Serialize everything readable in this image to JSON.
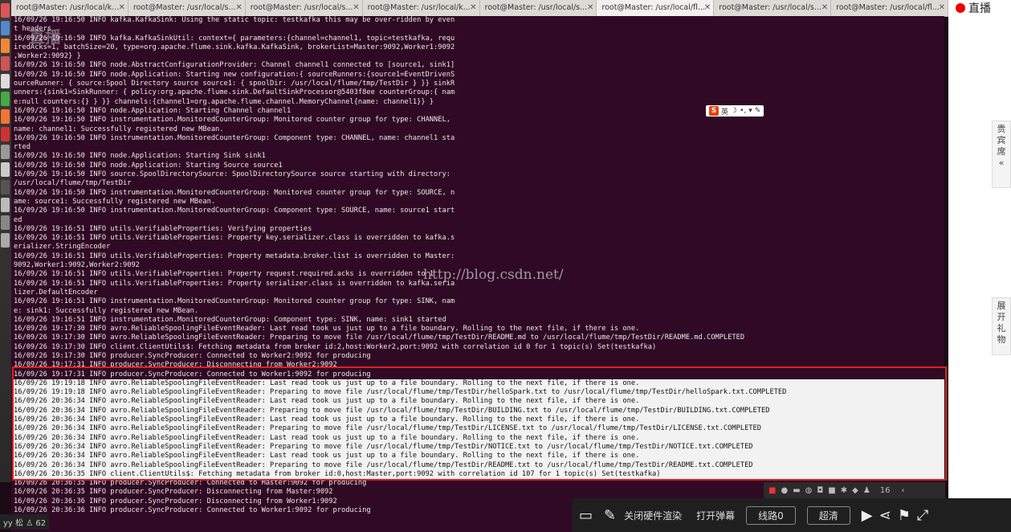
{
  "tabs": [
    {
      "label": "root@Master: /usr/local/k..."
    },
    {
      "label": "root@Master: /usr/local/s..."
    },
    {
      "label": "root@Master: /usr/local/s..."
    },
    {
      "label": "root@Master: /usr/local/k..."
    },
    {
      "label": "root@Master: /usr/local/s..."
    },
    {
      "label": "root@Master: /usr/local/fl..."
    },
    {
      "label": "root@Master: /usr/local/s..."
    },
    {
      "label": "root@Master: /usr/local/fl..."
    }
  ],
  "terminal": {
    "lines": [
      "16/09/26 19:16:50 INFO kafka.KafkaSink: Using the static topic: testkafka this may be over-ridden by even",
      "t headers",
      "16/09/26 19:16:50 INFO kafka.KafkaSinkUtil: context={ parameters:{channel=channel1, topic=testkafka, requ",
      "iredAcks=1, batchSize=20, type=org.apache.flume.sink.kafka.KafkaSink, brokerList=Master:9092,Worker1:9092",
      ",Worker2:9092} }",
      "16/09/26 19:16:50 INFO node.AbstractConfigurationProvider: Channel channel1 connected to [source1, sink1]",
      "16/09/26 19:16:50 INFO node.Application: Starting new configuration:{ sourceRunners:{source1=EventDrivenS",
      "ourceRunner: { source:Spool Directory source source1: { spoolDir: /usr/local/flume/tmp/TestDir } }} sinkR",
      "unners:{sink1=SinkRunner: { policy:org.apache.flume.sink.DefaultSinkProcessor@5403f8ee counterGroup:{ nam",
      "e:null counters:{} } }} channels:{channel1=org.apache.flume.channel.MemoryChannel{name: channel1}} }",
      "16/09/26 19:16:50 INFO node.Application: Starting Channel channel1",
      "16/09/26 19:16:50 INFO instrumentation.MonitoredCounterGroup: Monitored counter group for type: CHANNEL,",
      "name: channel1: Successfully registered new MBean.",
      "16/09/26 19:16:50 INFO instrumentation.MonitoredCounterGroup: Component type: CHANNEL, name: channel1 sta",
      "rted",
      "16/09/26 19:16:50 INFO node.Application: Starting Sink sink1",
      "16/09/26 19:16:50 INFO node.Application: Starting Source source1",
      "16/09/26 19:16:50 INFO source.SpoolDirectorySource: SpoolDirectorySource source starting with directory:",
      "/usr/local/flume/tmp/TestDir",
      "16/09/26 19:16:50 INFO instrumentation.MonitoredCounterGroup: Monitored counter group for type: SOURCE, n",
      "ame: source1: Successfully registered new MBean.",
      "16/09/26 19:16:50 INFO instrumentation.MonitoredCounterGroup: Component type: SOURCE, name: source1 start",
      "ed",
      "16/09/26 19:16:51 INFO utils.VerifiableProperties: Verifying properties",
      "16/09/26 19:16:51 INFO utils.VerifiableProperties: Property key.serializer.class is overridden to kafka.s",
      "erializer.StringEncoder",
      "16/09/26 19:16:51 INFO utils.VerifiableProperties: Property metadata.broker.list is overridden to Master:",
      "9092,Worker1:9092,Worker2:9092",
      "16/09/26 19:16:51 INFO utils.VerifiableProperties: Property request.required.acks is overridden to 1",
      "16/09/26 19:16:51 INFO utils.VerifiableProperties: Property serializer.class is overridden to kafka.seria",
      "lizer.DefaultEncoder",
      "16/09/26 19:16:51 INFO instrumentation.MonitoredCounterGroup: Monitored counter group for type: SINK, nam",
      "e: sink1: Successfully registered new MBean.",
      "16/09/26 19:16:51 INFO instrumentation.MonitoredCounterGroup: Component type: SINK, name: sink1 started",
      "16/09/26 19:17:30 INFO avro.ReliableSpoolingFileEventReader: Last read took us just up to a file boundary. Rolling to the next file, if there is one.",
      "16/09/26 19:17:30 INFO avro.ReliableSpoolingFileEventReader: Preparing to move file /usr/local/flume/tmp/TestDir/README.md to /usr/local/flume/tmp/TestDir/README.md.COMPLETED",
      "16/09/26 19:17:30 INFO client.ClientUtils$: Fetching metadata from broker id:2,host:Worker2,port:9092 with correlation id 0 for 1 topic(s) Set(testkafka)",
      "16/09/26 19:17:30 INFO producer.SyncProducer: Connected to Worker2:9092 for producing",
      "16/09/26 19:17:31 INFO producer.SyncProducer: Disconnecting from Worker2:9092",
      "16/09/26 19:17:31 INFO producer.SyncProducer: Connected to Worker1:9092 for producing",
      "16/09/26 19:19:18 INFO avro.ReliableSpoolingFileEventReader: Last read took us just up to a file boundary. Rolling to the next file, if there is one.",
      "16/09/26 19:19:18 INFO avro.ReliableSpoolingFileEventReader: Preparing to move file /usr/local/flume/tmp/TestDir/helloSpark.txt to /usr/local/flume/tmp/TestDir/helloSpark.txt.COMPLETED",
      "16/09/26 20:36:34 INFO avro.ReliableSpoolingFileEventReader: Last read took us just up to a file boundary. Rolling to the next file, if there is one.",
      "16/09/26 20:36:34 INFO avro.ReliableSpoolingFileEventReader: Preparing to move file /usr/local/flume/tmp/TestDir/BUILDING.txt to /usr/local/flume/tmp/TestDir/BUILDING.txt.COMPLETED",
      "16/09/26 20:36:34 INFO avro.ReliableSpoolingFileEventReader: Last read took us just up to a file boundary. Rolling to the next file, if there is one.",
      "16/09/26 20:36:34 INFO avro.ReliableSpoolingFileEventReader: Preparing to move file /usr/local/flume/tmp/TestDir/LICENSE.txt to /usr/local/flume/tmp/TestDir/LICENSE.txt.COMPLETED",
      "16/09/26 20:36:34 INFO avro.ReliableSpoolingFileEventReader: Last read took us just up to a file boundary. Rolling to the next file, if there is one.",
      "16/09/26 20:36:34 INFO avro.ReliableSpoolingFileEventReader: Preparing to move file /usr/local/flume/tmp/TestDir/NOTICE.txt to /usr/local/flume/tmp/TestDir/NOTICE.txt.COMPLETED",
      "16/09/26 20:36:34 INFO avro.ReliableSpoolingFileEventReader: Last read took us just up to a file boundary. Rolling to the next file, if there is one.",
      "16/09/26 20:36:34 INFO avro.ReliableSpoolingFileEventReader: Preparing to move file /usr/local/flume/tmp/TestDir/README.txt to /usr/local/flume/tmp/TestDir/README.txt.COMPLETED",
      "16/09/26 20:36:35 INFO client.ClientUtils$: Fetching metadata from broker id:0,host:Master,port:9092 with correlation id 107 for 1 topic(s) Set(testkafka)",
      "16/09/26 20:36:35 INFO producer.SyncProducer: Connected to Master:9092 for producing",
      "16/09/26 20:36:35 INFO producer.SyncProducer: Disconnecting from Master:9092",
      "16/09/26 20:36:36 INFO producer.SyncProducer: Disconnecting from Worker1:9092",
      "16/09/26 20:36:36 INFO producer.SyncProducer: Connected to Worker1:9092 for producing"
    ]
  },
  "overlay": {
    "live_label": "直播",
    "guest_tab": "贵宾席",
    "guest_chevron": "«",
    "gift_tab": "展开礼物",
    "watermark": "http://blog.csdn.net/",
    "logo_watermark": "直播",
    "ime_s": "S",
    "ime_lang": "英",
    "strip_count": "16",
    "corner_label": "yy 松",
    "viewer_count": "62"
  },
  "player": {
    "close_hw_render": "关闭硬件渲染",
    "open_danmaku": "打开弹幕",
    "route": "线路0",
    "quality": "超清"
  },
  "colors": {
    "terminal_bg": "#300a24",
    "highlight_box": "#e02020",
    "live_dot": "#ee0000"
  }
}
